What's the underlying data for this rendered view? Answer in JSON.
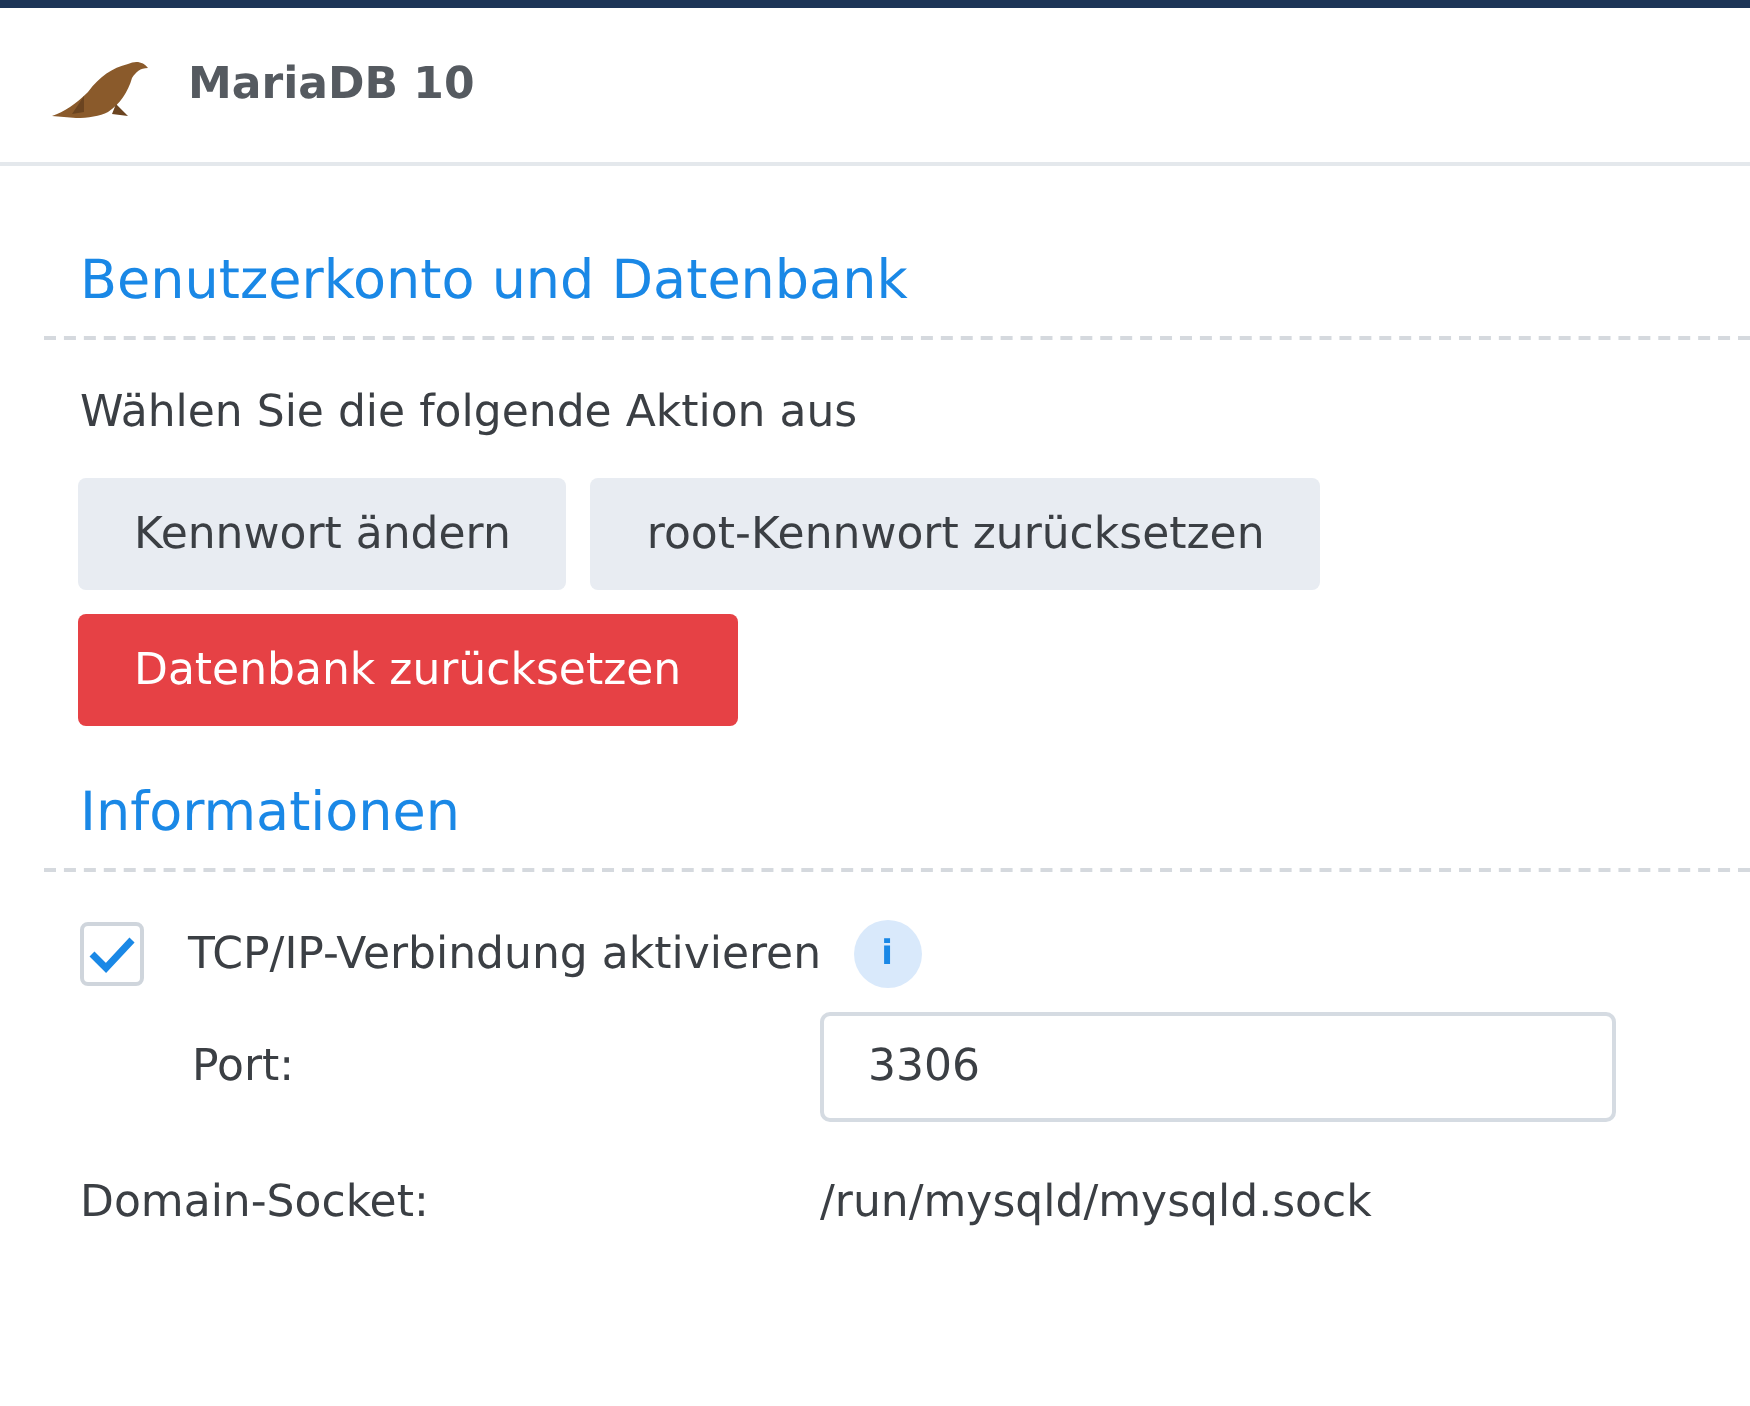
{
  "header": {
    "title": "MariaDB 10"
  },
  "sections": [
    {
      "title": "Benutzerkonto und Datenbank",
      "kind": "actions",
      "prompt": "Wählen Sie die folgende Aktion aus",
      "buttons": [
        {
          "label": "Kennwort ändern",
          "kind": "normal"
        },
        {
          "label": "root-Kennwort zurücksetzen",
          "kind": "normal"
        },
        {
          "label": "Datenbank zurücksetzen",
          "kind": "danger"
        }
      ]
    },
    {
      "title": "Informationen",
      "kind": "info",
      "checkbox": {
        "label": "TCP/IP-Verbindung aktivieren",
        "checked": true,
        "info": "i"
      },
      "port": {
        "label": "Port:",
        "value": "3306"
      },
      "socket": {
        "label": "Domain-Socket:",
        "value": "/run/mysqld/mysqld.sock"
      }
    }
  ]
}
